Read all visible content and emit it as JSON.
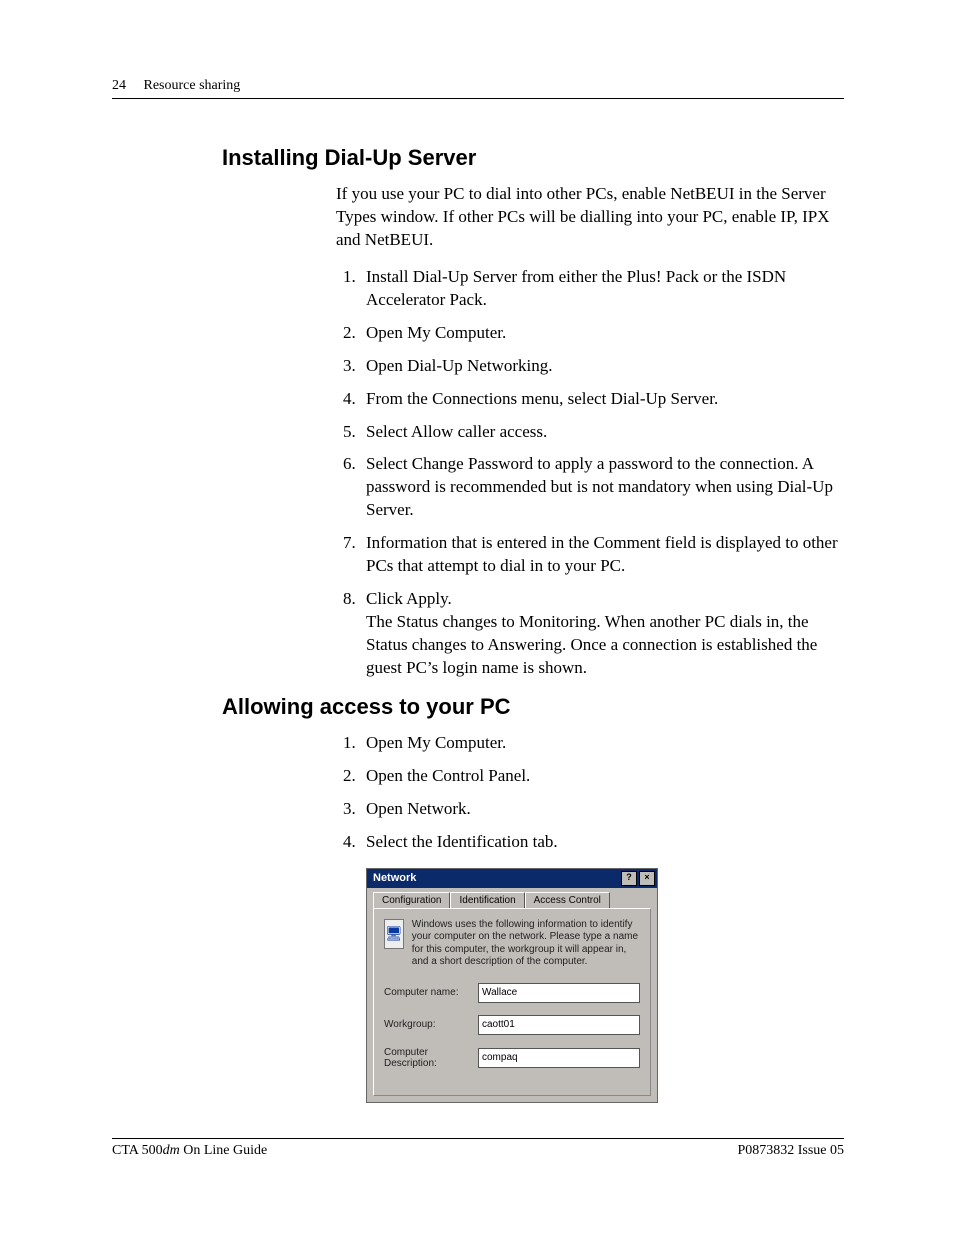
{
  "header": {
    "page_number": "24",
    "section": "Resource sharing"
  },
  "section1": {
    "title": "Installing Dial-Up Server",
    "intro": "If you use your PC to dial into other PCs, enable NetBEUI in the Server Types window. If other PCs will be dialling into your PC, enable IP, IPX and NetBEUI.",
    "steps": {
      "s1": "Install Dial-Up Server from either the Plus! Pack or the ISDN Accelerator Pack.",
      "s2": "Open My Computer.",
      "s3": "Open Dial-Up Networking.",
      "s4": "From the Connections menu, select Dial-Up Server.",
      "s5": "Select Allow caller access.",
      "s6": "Select Change Password to apply a password to the connection. A password is recommended but is not mandatory when using Dial-Up Server.",
      "s7": "Information that is entered in the Comment field is displayed to other PCs that attempt to dial in to your PC.",
      "s8": "Click Apply.",
      "s8_sub": "The Status changes to Monitoring. When another PC dials in, the Status changes to Answering. Once a connection is established the guest PC’s login name is shown."
    }
  },
  "section2": {
    "title": "Allowing access to your PC",
    "steps": {
      "s1": "Open My Computer.",
      "s2": "Open the Control Panel.",
      "s3": "Open Network.",
      "s4": "Select the Identification tab."
    }
  },
  "dialog": {
    "title": "Network",
    "help_glyph": "?",
    "close_glyph": "×",
    "tabs": {
      "configuration": "Configuration",
      "identification": "Identification",
      "access_control": "Access Control"
    },
    "info_text": "Windows uses the following information to identify your computer on the network. Please type a name for this computer, the workgroup it will appear in, and a short description of the computer.",
    "labels": {
      "computer_name": "Computer name:",
      "workgroup": "Workgroup:",
      "computer_description": "Computer Description:"
    },
    "values": {
      "computer_name": "Wallace",
      "workgroup": "caott01",
      "computer_description": "compaq"
    },
    "icon_glyph": "🖥"
  },
  "footer": {
    "left_prefix": "CTA 500",
    "left_italic": "dm",
    "left_suffix": " On Line Guide",
    "right": "P0873832  Issue 05"
  }
}
